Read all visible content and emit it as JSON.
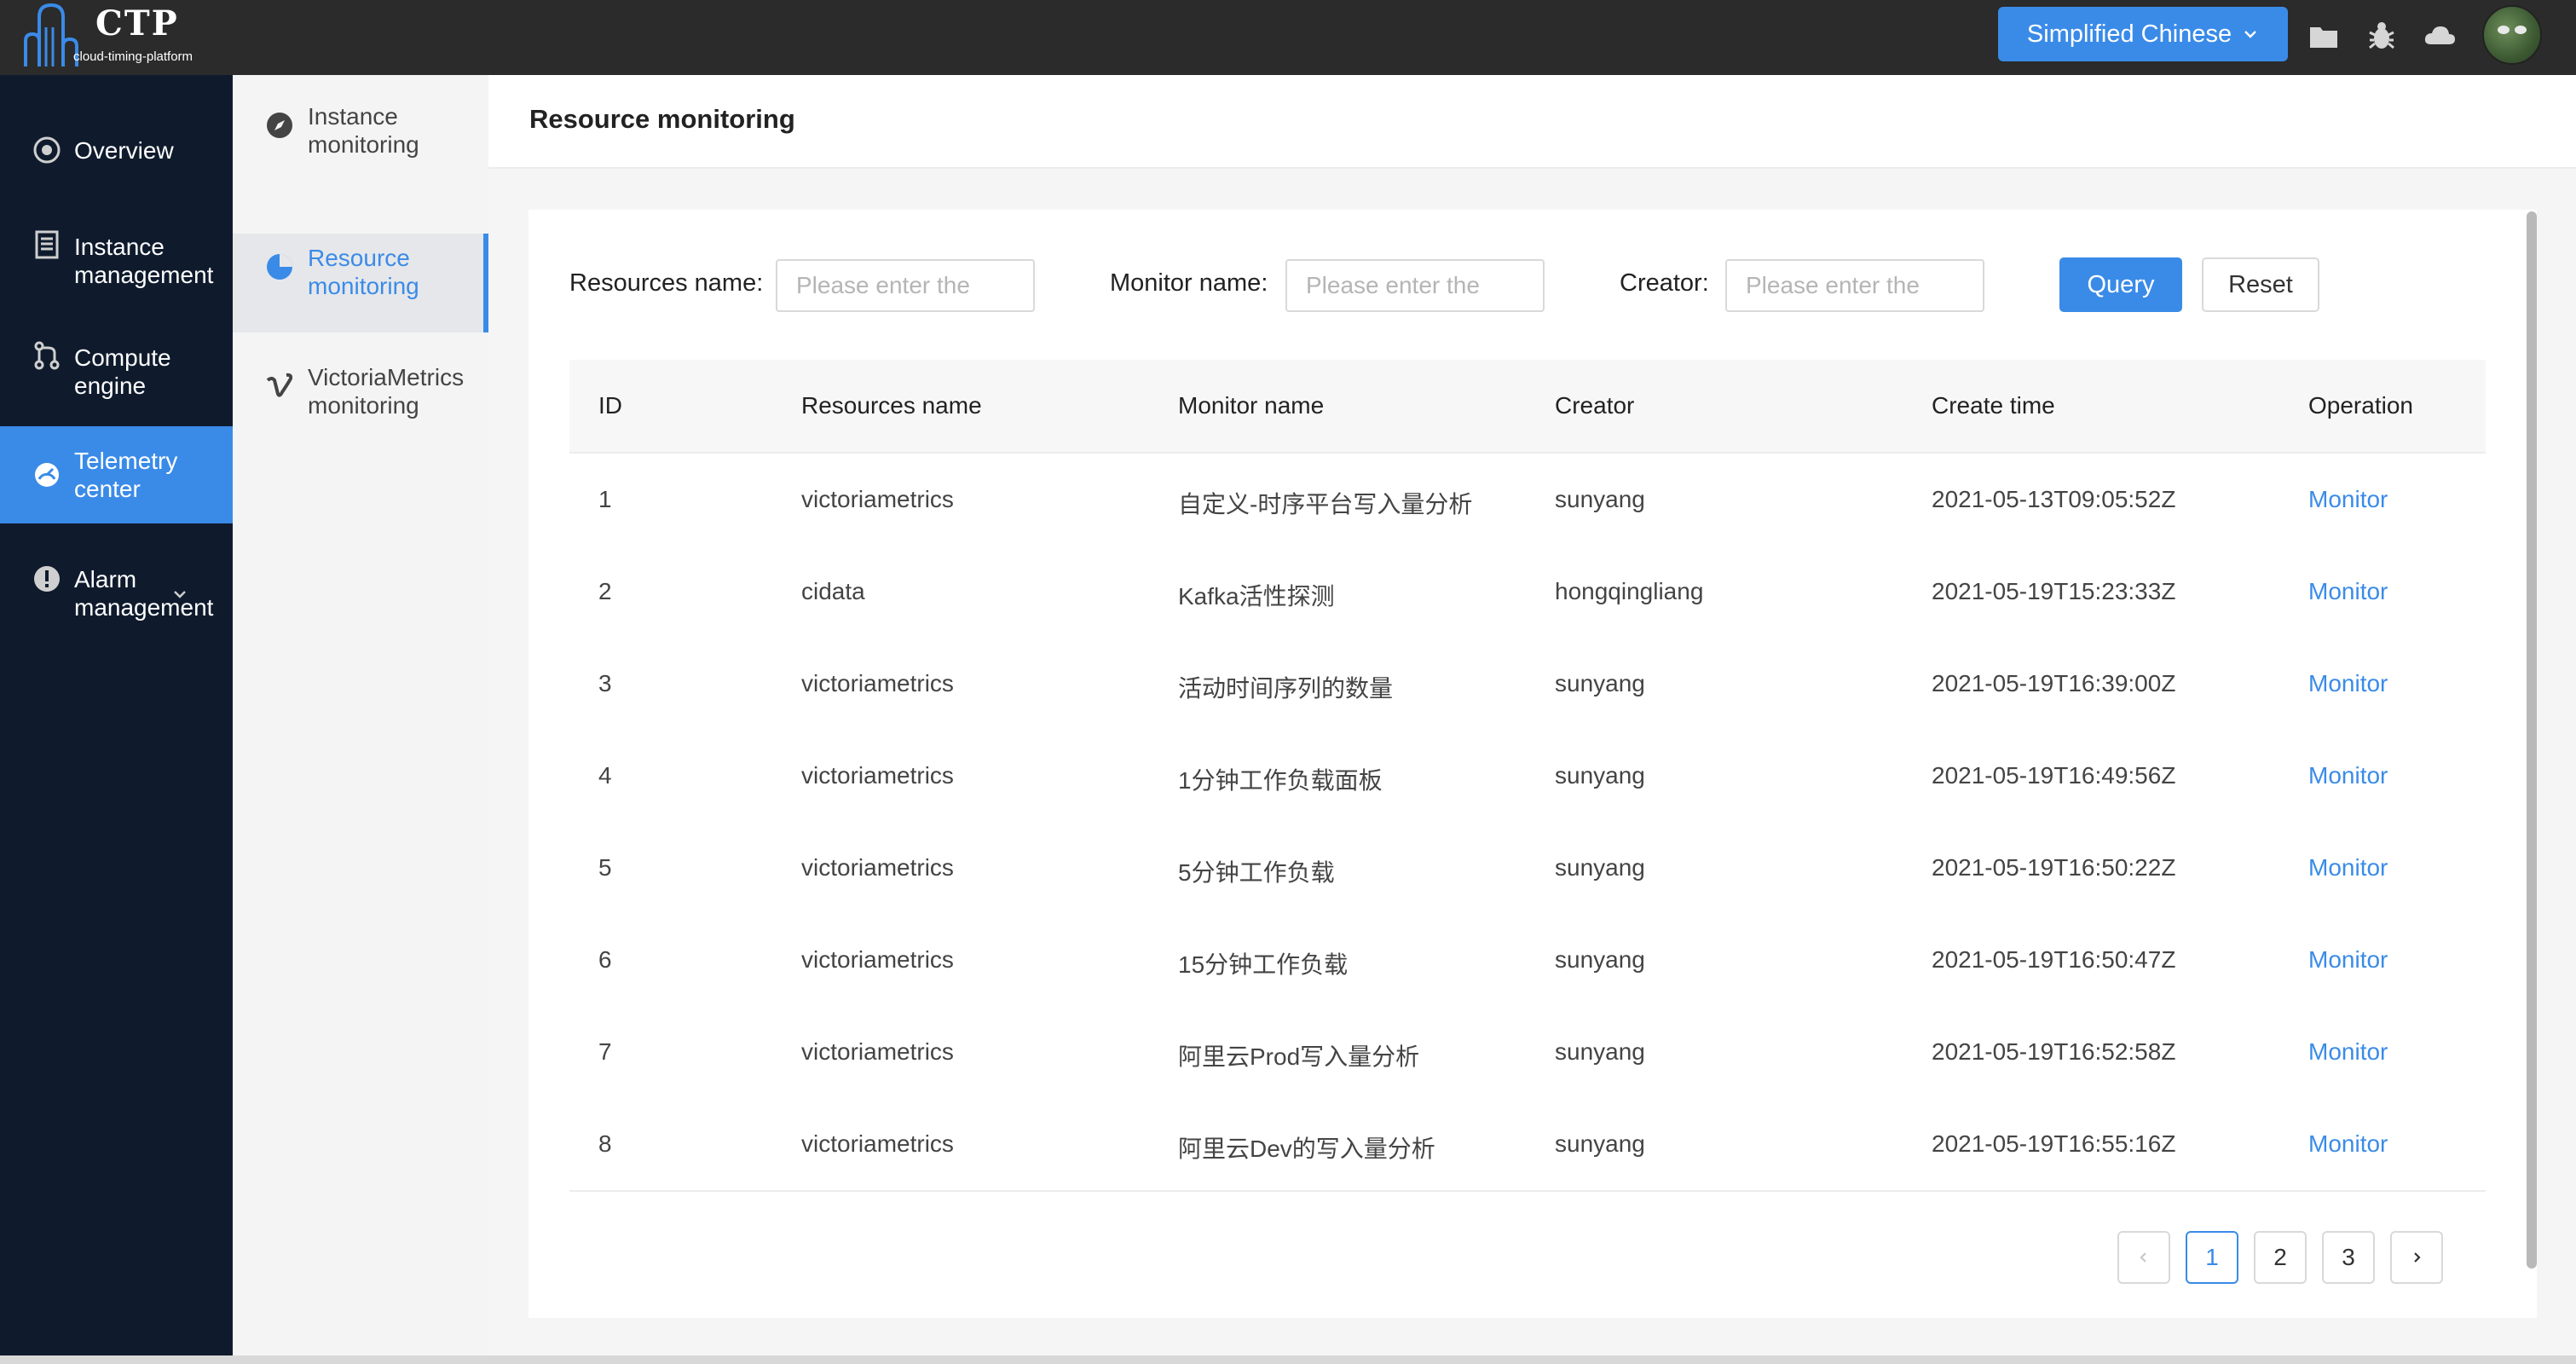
{
  "app": {
    "logo_title": "CTP",
    "logo_subtitle": "cloud-timing-platform",
    "language_label": "Simplified Chinese"
  },
  "sidebar": {
    "items": [
      {
        "label": "Overview",
        "icon": "overview-icon",
        "active": false
      },
      {
        "label": "Instance management",
        "icon": "document-icon",
        "active": false
      },
      {
        "label": "Compute engine",
        "icon": "branch-icon",
        "active": false
      },
      {
        "label": "Telemetry center",
        "icon": "dashboard-icon",
        "active": true
      },
      {
        "label": "Alarm management",
        "icon": "alert-icon",
        "active": false
      }
    ]
  },
  "submenu": {
    "items": [
      {
        "label": "Instance monitoring",
        "icon": "compass-icon",
        "active": false
      },
      {
        "label": "Resource monitoring",
        "icon": "pie-chart-icon",
        "active": true
      },
      {
        "label": "VictoriaMetrics monitoring",
        "icon": "vimeo-icon",
        "active": false
      }
    ]
  },
  "page": {
    "title": "Resource monitoring"
  },
  "filters": {
    "resources_name_label": "Resources name",
    "resources_name_placeholder": "Please enter the",
    "monitor_name_label": "Monitor name",
    "monitor_name_placeholder": "Please enter the",
    "creator_label": "Creator",
    "creator_placeholder": "Please enter the",
    "query_label": "Query",
    "reset_label": "Reset"
  },
  "table": {
    "columns": [
      "ID",
      "Resources name",
      "Monitor name",
      "Creator",
      "Create time",
      "Operation"
    ],
    "rows": [
      {
        "id": "1",
        "resource": "victoriametrics",
        "monitor": "自定义-时序平台写入量分析",
        "creator": "sunyang",
        "time": "2021-05-13T09:05:52Z",
        "op": "Monitor"
      },
      {
        "id": "2",
        "resource": "cidata",
        "monitor": "Kafka活性探测",
        "creator": "hongqingliang",
        "time": "2021-05-19T15:23:33Z",
        "op": "Monitor"
      },
      {
        "id": "3",
        "resource": "victoriametrics",
        "monitor": "活动时间序列的数量",
        "creator": "sunyang",
        "time": "2021-05-19T16:39:00Z",
        "op": "Monitor"
      },
      {
        "id": "4",
        "resource": "victoriametrics",
        "monitor": "1分钟工作负载面板",
        "creator": "sunyang",
        "time": "2021-05-19T16:49:56Z",
        "op": "Monitor"
      },
      {
        "id": "5",
        "resource": "victoriametrics",
        "monitor": "5分钟工作负载",
        "creator": "sunyang",
        "time": "2021-05-19T16:50:22Z",
        "op": "Monitor"
      },
      {
        "id": "6",
        "resource": "victoriametrics",
        "monitor": "15分钟工作负载",
        "creator": "sunyang",
        "time": "2021-05-19T16:50:47Z",
        "op": "Monitor"
      },
      {
        "id": "7",
        "resource": "victoriametrics",
        "monitor": "阿里云Prod写入量分析",
        "creator": "sunyang",
        "time": "2021-05-19T16:52:58Z",
        "op": "Monitor"
      },
      {
        "id": "8",
        "resource": "victoriametrics",
        "monitor": "阿里云Dev的写入量分析",
        "creator": "sunyang",
        "time": "2021-05-19T16:55:16Z",
        "op": "Monitor"
      }
    ]
  },
  "pagination": {
    "pages": [
      "1",
      "2",
      "3"
    ],
    "current": "1"
  },
  "colors": {
    "accent": "#3a8be8",
    "sidebar_bg": "#0f1b2d",
    "topbar_bg": "#2b2b2b"
  }
}
